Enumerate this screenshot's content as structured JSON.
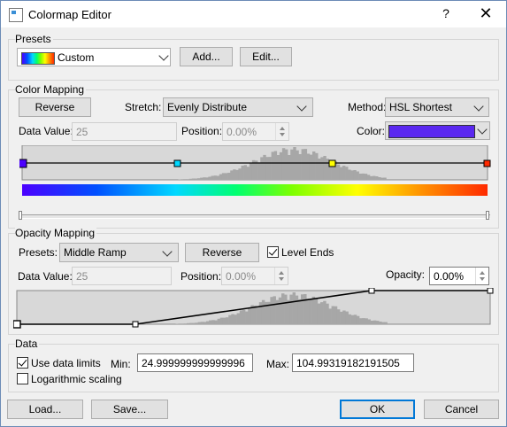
{
  "window": {
    "title": "Colormap Editor",
    "help_glyph": "?",
    "close_glyph": "✕"
  },
  "presets": {
    "group_label": "Presets",
    "selected": "Custom",
    "add_label": "Add...",
    "edit_label": "Edit..."
  },
  "color_mapping": {
    "group_label": "Color Mapping",
    "reverse_label": "Reverse",
    "stretch_label": "Stretch:",
    "stretch_value": "Evenly Distribute",
    "method_label": "Method:",
    "method_value": "HSL Shortest",
    "data_value_label": "Data Value:",
    "data_value": "25",
    "position_label": "Position:",
    "position_value": "0.00%",
    "color_label": "Color:",
    "color_swatch": "#5a28f0",
    "control_point_colors": [
      "#4b00ff",
      "#00d8ff",
      "#ffff00",
      "#ff2a00"
    ],
    "gradient_colors": [
      "#4b00ff",
      "#0050ff",
      "#00d8ff",
      "#00ff70",
      "#7dff00",
      "#ffff00",
      "#ff9000",
      "#ff2a00"
    ]
  },
  "opacity_mapping": {
    "group_label": "Opacity Mapping",
    "presets_label": "Presets:",
    "preset_value": "Middle Ramp",
    "reverse_label": "Reverse",
    "level_ends_label": "Level Ends",
    "level_ends_checked": true,
    "data_value_label": "Data Value:",
    "data_value": "25",
    "position_label": "Position:",
    "position_value": "0.00%",
    "opacity_label": "Opacity:",
    "opacity_value": "0.00%"
  },
  "data": {
    "group_label": "Data",
    "use_limits_label": "Use data limits",
    "use_limits_checked": true,
    "log_scaling_label": "Logarithmic scaling",
    "log_scaling_checked": false,
    "min_label": "Min:",
    "min_value": "24.999999999999996",
    "max_label": "Max:",
    "max_value": "104.99319182191505"
  },
  "footer": {
    "load_label": "Load...",
    "save_label": "Save...",
    "ok_label": "OK",
    "cancel_label": "Cancel"
  },
  "colors": {
    "accent": "#0078d7",
    "histogram": "#a7a7a7",
    "chart_bg": "#d8d8d8"
  }
}
